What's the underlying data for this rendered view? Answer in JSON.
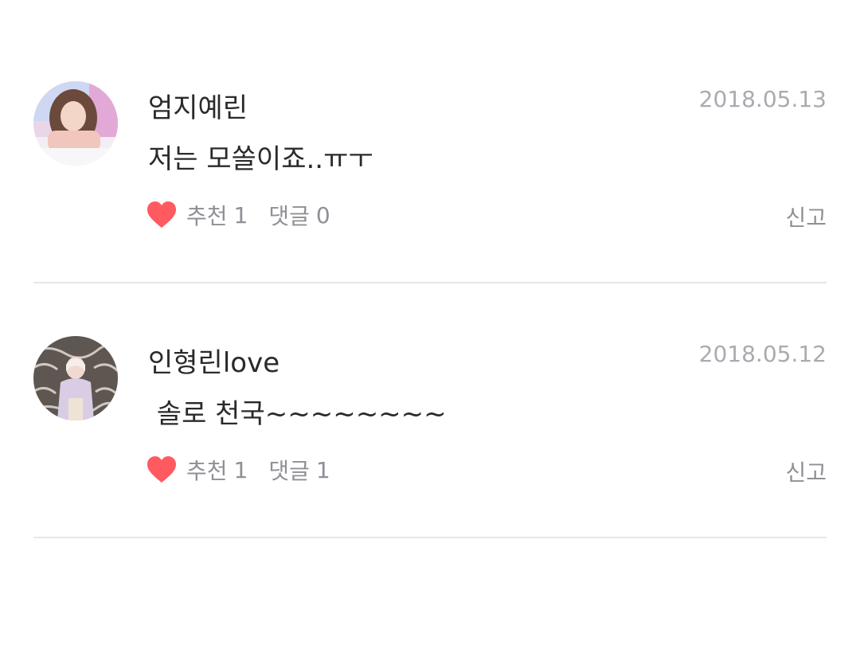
{
  "comments": [
    {
      "author": "엄지예린",
      "date": "2018.05.13",
      "text": "저는 모쏠이죠..ㅠㅜ",
      "like_label": "추천",
      "like_count": "1",
      "reply_label": "댓글",
      "reply_count": "0",
      "report_label": "신고"
    },
    {
      "author": "인형린love",
      "date": "2018.05.12",
      "text": " 솔로 천국~~~~~~~~",
      "like_label": "추천",
      "like_count": "1",
      "reply_label": "댓글",
      "reply_count": "1",
      "report_label": "신고"
    }
  ],
  "colors": {
    "heart": "#ff5a5f",
    "meta_text": "#8e9096",
    "date_text": "#a9abb0",
    "divider": "#e6e7e9"
  },
  "icons": {
    "like": "heart-icon"
  }
}
